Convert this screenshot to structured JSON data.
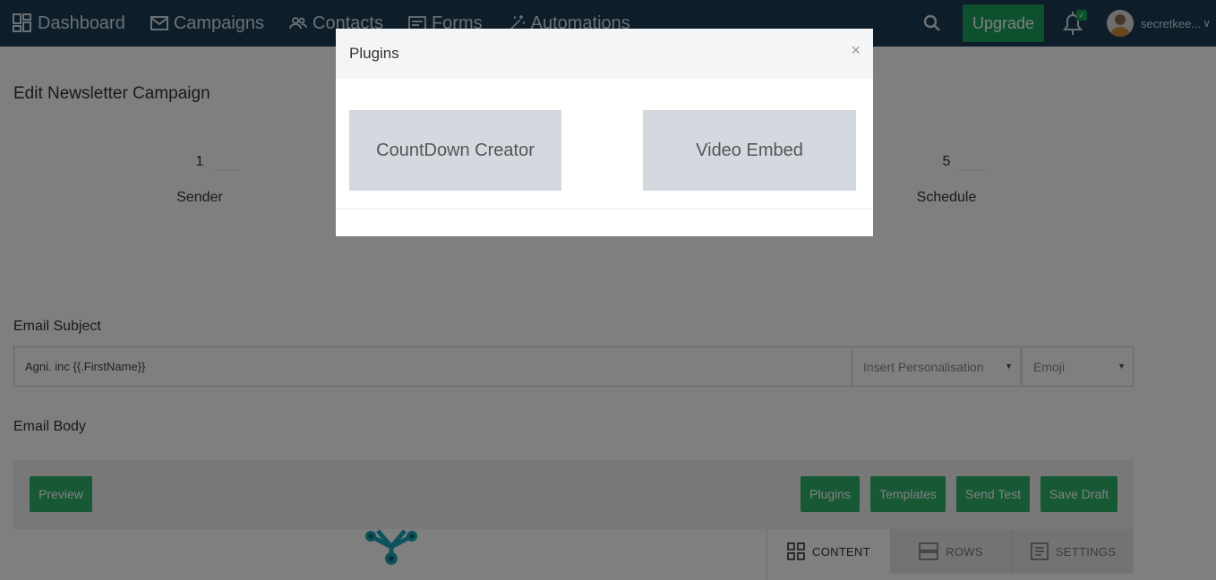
{
  "nav": {
    "items": [
      {
        "label": "Dashboard",
        "icon": "dashboard-icon"
      },
      {
        "label": "Campaigns",
        "icon": "mail-icon"
      },
      {
        "label": "Contacts",
        "icon": "contacts-icon"
      },
      {
        "label": "Forms",
        "icon": "forms-icon"
      },
      {
        "label": "Automations",
        "icon": "magic-wand-icon"
      }
    ],
    "upgrade_label": "Upgrade",
    "user_name": "secretkee...",
    "user_chevron": "∨",
    "bell_badge": "✓"
  },
  "page": {
    "title": "Edit Newsletter Campaign",
    "steps": [
      {
        "num": "1",
        "label": "Sender"
      },
      {
        "num": "5",
        "label": "Schedule"
      }
    ],
    "email_subject_label": "Email Subject",
    "email_subject_value": "Agni. inc {{.FirstName}}",
    "insert_personalisation": "Insert Personalisation",
    "emoji": "Emoji",
    "email_body_label": "Email Body"
  },
  "toolbar": {
    "preview": "Preview",
    "plugins": "Plugins",
    "templates": "Templates",
    "send_test": "Send Test",
    "save_draft": "Save Draft"
  },
  "editor_tabs": {
    "content": "CONTENT",
    "rows": "ROWS",
    "settings": "SETTINGS"
  },
  "modal": {
    "title": "Plugins",
    "close": "×",
    "plugins": [
      {
        "label": "CountDown Creator"
      },
      {
        "label": "Video Embed"
      }
    ]
  },
  "colors": {
    "nav_bg": "#1b3a52",
    "accent_green": "#18a05a",
    "card_bg": "#d4d8df"
  }
}
